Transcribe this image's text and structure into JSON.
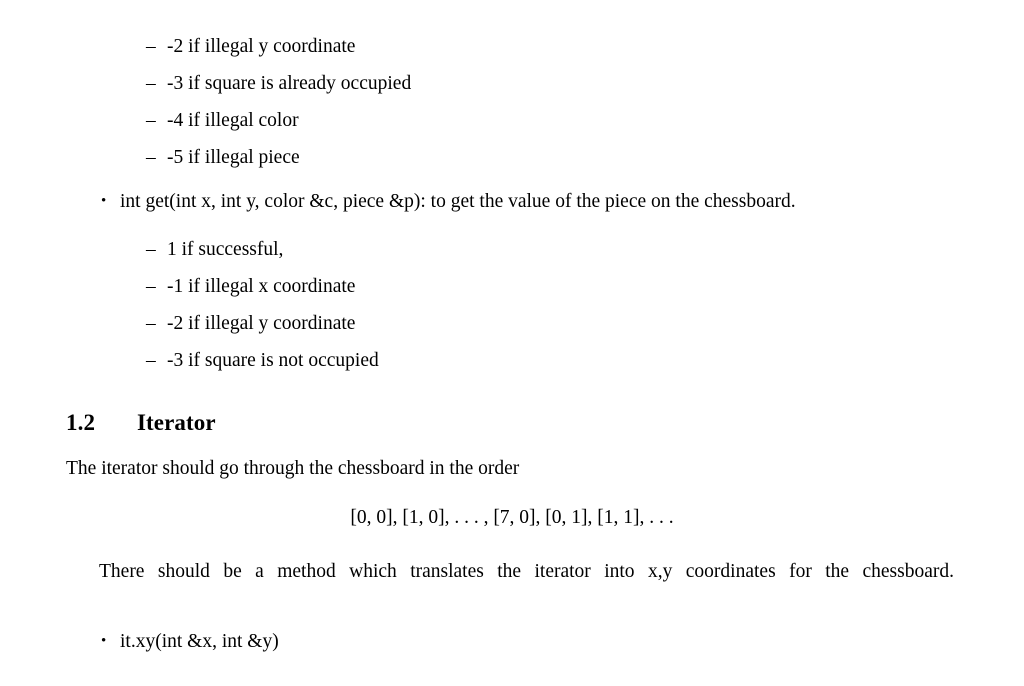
{
  "document": {
    "list_one": {
      "items": [
        {
          "marker": "–",
          "text": "-2 if illegal y coordinate"
        },
        {
          "marker": "–",
          "text": "-3 if square is already occupied"
        },
        {
          "marker": "–",
          "text": "-4 if illegal color"
        },
        {
          "marker": "–",
          "text": "-5 if illegal piece"
        }
      ]
    },
    "get_bullet": {
      "marker": "•",
      "text": "int get(int x, int y, color &c, piece &p): to get the value of the piece on the chessboard."
    },
    "list_two": {
      "items": [
        {
          "marker": "–",
          "text": "1 if successful,"
        },
        {
          "marker": "–",
          "text": "-1 if illegal x coordinate"
        },
        {
          "marker": "–",
          "text": "-2 if illegal y coordinate"
        },
        {
          "marker": "–",
          "text": "-3 if square is not occupied"
        }
      ]
    },
    "section": {
      "number": "1.2",
      "title": "Iterator"
    },
    "intro_line": "The iterator should go through the chessboard in the order",
    "display_math": "[0, 0], [1, 0], . . . , [7, 0], [0, 1], [1, 1], . . .",
    "paragraph": "There should be a method which translates the iterator into x,y coordinates for the chessboard.",
    "xy_bullet": {
      "marker": "•",
      "text": "it.xy(int &x, int &y)"
    }
  }
}
